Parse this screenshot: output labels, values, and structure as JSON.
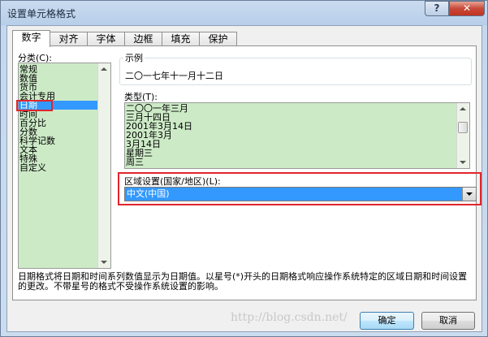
{
  "window": {
    "title": "设置单元格格式",
    "help_label": "?",
    "close_label": "✕"
  },
  "tabs": [
    {
      "label": "数字",
      "active": true
    },
    {
      "label": "对齐",
      "active": false
    },
    {
      "label": "字体",
      "active": false
    },
    {
      "label": "边框",
      "active": false
    },
    {
      "label": "填充",
      "active": false
    },
    {
      "label": "保护",
      "active": false
    }
  ],
  "category": {
    "label": "分类(C):",
    "items": [
      "常规",
      "数值",
      "货币",
      "会计专用",
      "日期",
      "时间",
      "百分比",
      "分数",
      "科学记数",
      "文本",
      "特殊",
      "自定义"
    ],
    "selected": "日期"
  },
  "sample": {
    "label": "示例",
    "value": "二〇一七年十一月十二日"
  },
  "type": {
    "label": "类型(T):",
    "items": [
      "二〇〇一年三月",
      "三月十四日",
      "2001年3月14日",
      "2001年3月",
      "3月14日",
      "星期三",
      "周三"
    ]
  },
  "locale": {
    "label": "区域设置(国家/地区)(L):",
    "value": "中文(中国)"
  },
  "description": "日期格式将日期和时间系列数值显示为日期值。以星号(*)开头的日期格式响应操作系统特定的区域日期和时间设置的更改。不带星号的格式不受操作系统设置的影响。",
  "buttons": {
    "ok": "确定",
    "cancel": "取消"
  },
  "watermark": "http://blog.csdn.net/",
  "colors": {
    "list_background": "#cdeac7",
    "selection": "#3399ff",
    "highlight_border": "#e0262c"
  }
}
